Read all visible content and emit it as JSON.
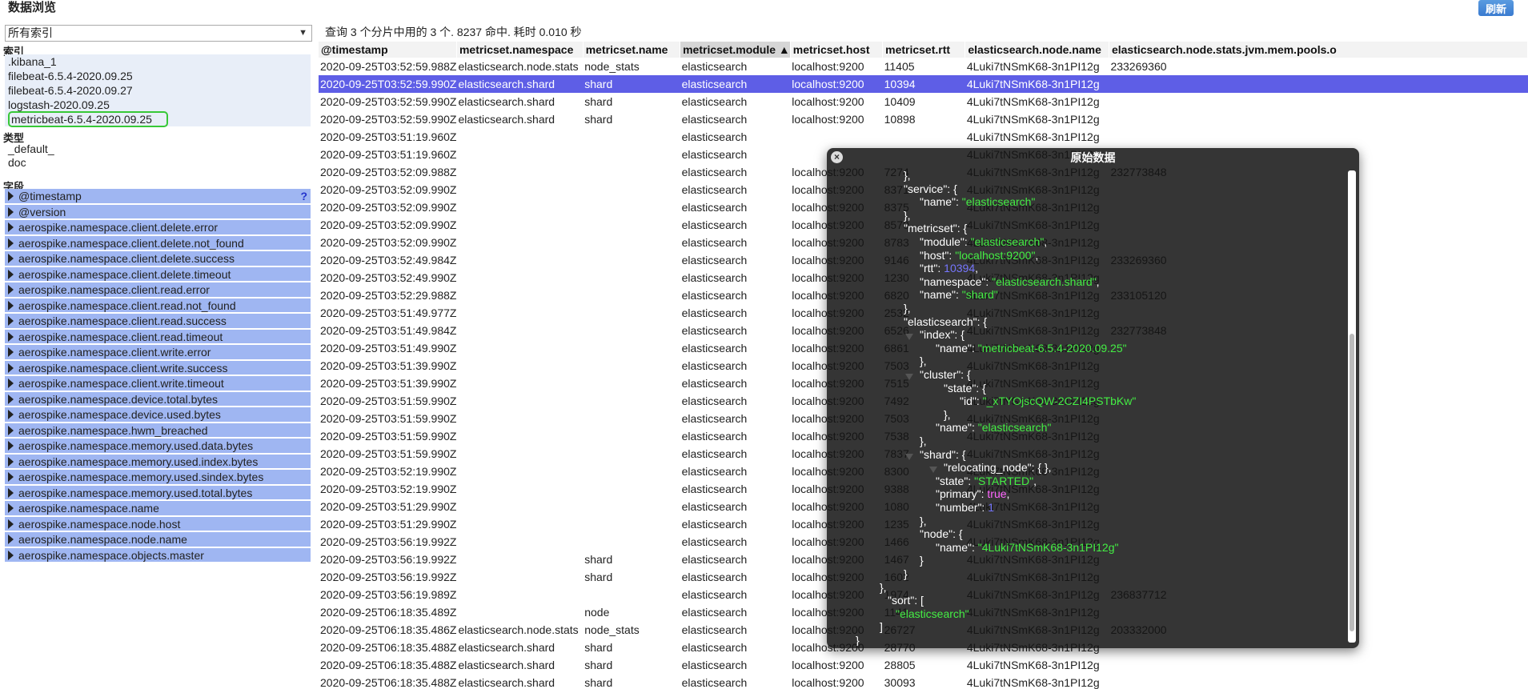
{
  "app": {
    "title": "数据浏览",
    "refresh_label": "刷新"
  },
  "sidebar": {
    "index_select": "所有索引",
    "index_heading": "索引",
    "indices": [
      ".kibana_1",
      "filebeat-6.5.4-2020.09.25",
      "filebeat-6.5.4-2020.09.27",
      "logstash-2020.09.25",
      "metricbeat-6.5.4-2020.09.25"
    ],
    "selected_index": 4,
    "type_heading": "类型",
    "types": [
      "_default_",
      "doc"
    ],
    "field_heading": "字段",
    "help_icon": "?",
    "fields": [
      "@timestamp",
      "@version",
      "aerospike.namespace.client.delete.error",
      "aerospike.namespace.client.delete.not_found",
      "aerospike.namespace.client.delete.success",
      "aerospike.namespace.client.delete.timeout",
      "aerospike.namespace.client.read.error",
      "aerospike.namespace.client.read.not_found",
      "aerospike.namespace.client.read.success",
      "aerospike.namespace.client.read.timeout",
      "aerospike.namespace.client.write.error",
      "aerospike.namespace.client.write.success",
      "aerospike.namespace.client.write.timeout",
      "aerospike.namespace.device.total.bytes",
      "aerospike.namespace.device.used.bytes",
      "aerospike.namespace.hwm_breached",
      "aerospike.namespace.memory.used.data.bytes",
      "aerospike.namespace.memory.used.index.bytes",
      "aerospike.namespace.memory.used.sindex.bytes",
      "aerospike.namespace.memory.used.total.bytes",
      "aerospike.namespace.name",
      "aerospike.namespace.node.host",
      "aerospike.namespace.node.name",
      "aerospike.namespace.objects.master"
    ]
  },
  "main": {
    "query_info": "查询 3 个分片中用的 3 个. 8237 命中. 耗时 0.010 秒",
    "columns": [
      "@timestamp",
      "metricset.namespace",
      "metricset.name",
      "metricset.module ▲",
      "metricset.host",
      "metricset.rtt",
      "elasticsearch.node.name",
      "elasticsearch.node.stats.jvm.mem.pools.o"
    ],
    "sorted_column": 3,
    "selected_row": 1,
    "rows": [
      [
        "2020-09-25T03:52:59.988Z",
        "elasticsearch.node.stats",
        "node_stats",
        "elasticsearch",
        "localhost:9200",
        "11405",
        "4Luki7tNSmK68-3n1PI12g",
        "233269360"
      ],
      [
        "2020-09-25T03:52:59.990Z",
        "elasticsearch.shard",
        "shard",
        "elasticsearch",
        "localhost:9200",
        "10394",
        "4Luki7tNSmK68-3n1PI12g",
        ""
      ],
      [
        "2020-09-25T03:52:59.990Z",
        "elasticsearch.shard",
        "shard",
        "elasticsearch",
        "localhost:9200",
        "10409",
        "4Luki7tNSmK68-3n1PI12g",
        ""
      ],
      [
        "2020-09-25T03:52:59.990Z",
        "elasticsearch.shard",
        "shard",
        "elasticsearch",
        "localhost:9200",
        "10898",
        "4Luki7tNSmK68-3n1PI12g",
        ""
      ],
      [
        "2020-09-25T03:51:19.960Z",
        "",
        "",
        "elasticsearch",
        "",
        "",
        "4Luki7tNSmK68-3n1PI12g",
        ""
      ],
      [
        "2020-09-25T03:51:19.960Z",
        "",
        "",
        "elasticsearch",
        "",
        "",
        "4Luki7tNSmK68-3n1PI12g",
        ""
      ],
      [
        "2020-09-25T03:52:09.988Z",
        "",
        "",
        "elasticsearch",
        "localhost:9200",
        "7274",
        "4Luki7tNSmK68-3n1PI12g",
        "232773848"
      ],
      [
        "2020-09-25T03:52:09.990Z",
        "",
        "",
        "elasticsearch",
        "localhost:9200",
        "8371",
        "4Luki7tNSmK68-3n1PI12g",
        ""
      ],
      [
        "2020-09-25T03:52:09.990Z",
        "",
        "",
        "elasticsearch",
        "localhost:9200",
        "8375",
        "4Luki7tNSmK68-3n1PI12g",
        ""
      ],
      [
        "2020-09-25T03:52:09.990Z",
        "",
        "",
        "elasticsearch",
        "localhost:9200",
        "8570",
        "4Luki7tNSmK68-3n1PI12g",
        ""
      ],
      [
        "2020-09-25T03:52:09.990Z",
        "",
        "",
        "elasticsearch",
        "localhost:9200",
        "8783",
        "4Luki7tNSmK68-3n1PI12g",
        ""
      ],
      [
        "2020-09-25T03:52:49.984Z",
        "",
        "",
        "elasticsearch",
        "localhost:9200",
        "9146",
        "4Luki7tNSmK68-3n1PI12g",
        "233269360"
      ],
      [
        "2020-09-25T03:52:49.990Z",
        "",
        "",
        "elasticsearch",
        "localhost:9200",
        "1230",
        "4Luki7tNSmK68-3n1PI12g",
        ""
      ],
      [
        "2020-09-25T03:52:29.988Z",
        "",
        "",
        "elasticsearch",
        "localhost:9200",
        "6820",
        "4Luki7tNSmK68-3n1PI12g",
        "233105120"
      ],
      [
        "2020-09-25T03:51:49.977Z",
        "",
        "",
        "elasticsearch",
        "localhost:9200",
        "2532",
        "4Luki7tNSmK68-3n1PI12g",
        ""
      ],
      [
        "2020-09-25T03:51:49.984Z",
        "",
        "",
        "elasticsearch",
        "localhost:9200",
        "6526",
        "4Luki7tNSmK68-3n1PI12g",
        "232773848"
      ],
      [
        "2020-09-25T03:51:49.990Z",
        "",
        "",
        "elasticsearch",
        "localhost:9200",
        "6861",
        "4Luki7tNSmK68-3n1PI12g",
        ""
      ],
      [
        "2020-09-25T03:51:39.990Z",
        "",
        "",
        "elasticsearch",
        "localhost:9200",
        "7503",
        "4Luki7tNSmK68-3n1PI12g",
        ""
      ],
      [
        "2020-09-25T03:51:39.990Z",
        "",
        "",
        "elasticsearch",
        "localhost:9200",
        "7515",
        "4Luki7tNSmK68-3n1PI12g",
        ""
      ],
      [
        "2020-09-25T03:51:59.990Z",
        "",
        "",
        "elasticsearch",
        "localhost:9200",
        "7492",
        "4Luki7tNSmK68-3n1PI12g",
        ""
      ],
      [
        "2020-09-25T03:51:59.990Z",
        "",
        "",
        "elasticsearch",
        "localhost:9200",
        "7503",
        "4Luki7tNSmK68-3n1PI12g",
        ""
      ],
      [
        "2020-09-25T03:51:59.990Z",
        "",
        "",
        "elasticsearch",
        "localhost:9200",
        "7538",
        "4Luki7tNSmK68-3n1PI12g",
        ""
      ],
      [
        "2020-09-25T03:51:59.990Z",
        "",
        "",
        "elasticsearch",
        "localhost:9200",
        "7837",
        "4Luki7tNSmK68-3n1PI12g",
        ""
      ],
      [
        "2020-09-25T03:52:19.990Z",
        "",
        "",
        "elasticsearch",
        "localhost:9200",
        "8300",
        "4Luki7tNSmK68-3n1PI12g",
        ""
      ],
      [
        "2020-09-25T03:52:19.990Z",
        "",
        "",
        "elasticsearch",
        "localhost:9200",
        "9388",
        "4Luki7tNSmK68-3n1PI12g",
        ""
      ],
      [
        "2020-09-25T03:51:29.990Z",
        "",
        "",
        "elasticsearch",
        "localhost:9200",
        "1080",
        "4Luki7tNSmK68-3n1PI12g",
        ""
      ],
      [
        "2020-09-25T03:51:29.990Z",
        "",
        "",
        "elasticsearch",
        "localhost:9200",
        "1235",
        "4Luki7tNSmK68-3n1PI12g",
        ""
      ],
      [
        "2020-09-25T03:56:19.992Z",
        "",
        "",
        "elasticsearch",
        "localhost:9200",
        "1466",
        "4Luki7tNSmK68-3n1PI12g",
        ""
      ],
      [
        "2020-09-25T03:56:19.992Z",
        "",
        "shard",
        "elasticsearch",
        "localhost:9200",
        "1467",
        "4Luki7tNSmK68-3n1PI12g",
        ""
      ],
      [
        "2020-09-25T03:56:19.992Z",
        "",
        "shard",
        "elasticsearch",
        "localhost:9200",
        "1602",
        "4Luki7tNSmK68-3n1PI12g",
        ""
      ],
      [
        "2020-09-25T03:56:19.989Z",
        "",
        "",
        "elasticsearch",
        "localhost:9200",
        "1974",
        "4Luki7tNSmK68-3n1PI12g",
        "236837712"
      ],
      [
        "2020-09-25T06:18:35.489Z",
        "",
        "node",
        "elasticsearch",
        "localhost:9200",
        "1141",
        "4Luki7tNSmK68-3n1PI12g",
        ""
      ],
      [
        "2020-09-25T06:18:35.486Z",
        "elasticsearch.node.stats",
        "node_stats",
        "elasticsearch",
        "localhost:9200",
        "26727",
        "4Luki7tNSmK68-3n1PI12g",
        "203332000"
      ],
      [
        "2020-09-25T06:18:35.488Z",
        "elasticsearch.shard",
        "shard",
        "elasticsearch",
        "localhost:9200",
        "28770",
        "4Luki7tNSmK68-3n1PI12g",
        ""
      ],
      [
        "2020-09-25T06:18:35.488Z",
        "elasticsearch.shard",
        "shard",
        "elasticsearch",
        "localhost:9200",
        "28805",
        "4Luki7tNSmK68-3n1PI12g",
        ""
      ],
      [
        "2020-09-25T06:18:35.488Z",
        "elasticsearch.shard",
        "shard",
        "elasticsearch",
        "localhost:9200",
        "30093",
        "4Luki7tNSmK68-3n1PI12g",
        ""
      ]
    ]
  },
  "modal": {
    "title": "原始数据",
    "close_icon": "×",
    "lines": [
      [
        [
          {
            "t": "},",
            "c": "k"
          }
        ]
      ],
      [
        [
          {
            "t": "\"service\": {",
            "c": "k"
          }
        ]
      ],
      [
        [
          {
            "t": "\"name\": ",
            "c": "k"
          },
          {
            "t": "\"elasticsearch\"",
            "c": "s"
          }
        ]
      ],
      [
        [
          {
            "t": "},",
            "c": "k"
          }
        ]
      ],
      [
        [
          {
            "t": "\"metricset\": {",
            "c": "k"
          }
        ]
      ],
      [
        [
          {
            "t": "\"module\": ",
            "c": "k"
          },
          {
            "t": "\"elasticsearch\"",
            "c": "s"
          },
          {
            "t": ",",
            "c": "k"
          }
        ]
      ],
      [
        [
          {
            "t": "\"host\": ",
            "c": "k"
          },
          {
            "t": "\"localhost:9200\"",
            "c": "s"
          },
          {
            "t": ",",
            "c": "k"
          }
        ]
      ],
      [
        [
          {
            "t": "\"rtt\": ",
            "c": "k"
          },
          {
            "t": "10394",
            "c": "n"
          },
          {
            "t": ",",
            "c": "k"
          }
        ]
      ],
      [
        [
          {
            "t": "\"namespace\": ",
            "c": "k"
          },
          {
            "t": "\"elasticsearch.shard\"",
            "c": "s"
          },
          {
            "t": ",",
            "c": "k"
          }
        ]
      ],
      [
        [
          {
            "t": "\"name\": ",
            "c": "k"
          },
          {
            "t": "\"shard\"",
            "c": "s"
          }
        ]
      ],
      [
        [
          {
            "t": "},",
            "c": "k"
          }
        ]
      ],
      [
        [
          {
            "t": "\"elasticsearch\": {",
            "c": "k"
          }
        ]
      ],
      [
        [
          {
            "t": "\"index\": {",
            "c": "k"
          }
        ]
      ],
      [
        [
          {
            "t": "\"name\": ",
            "c": "k"
          },
          {
            "t": "\"metricbeat-6.5.4-2020.09.25\"",
            "c": "s"
          }
        ]
      ],
      [
        [
          {
            "t": "},",
            "c": "k"
          }
        ]
      ],
      [
        [
          {
            "t": "\"cluster\": {",
            "c": "k"
          }
        ]
      ],
      [
        [
          {
            "t": "\"state\": {",
            "c": "k"
          }
        ]
      ],
      [
        [
          {
            "t": "\"id\": ",
            "c": "k"
          },
          {
            "t": "\"_xTYOjscQW-2CZI4PSTbKw\"",
            "c": "s"
          }
        ]
      ],
      [
        [
          {
            "t": "},",
            "c": "k"
          }
        ]
      ],
      [
        [
          {
            "t": "\"name\": ",
            "c": "k"
          },
          {
            "t": "\"elasticsearch\"",
            "c": "s"
          }
        ]
      ],
      [
        [
          {
            "t": "},",
            "c": "k"
          }
        ]
      ],
      [
        [
          {
            "t": "\"shard\": {",
            "c": "k"
          }
        ]
      ],
      [
        [
          {
            "t": "\"relocating_node\": { },",
            "c": "k"
          }
        ]
      ],
      [
        [
          {
            "t": "\"state\": ",
            "c": "k"
          },
          {
            "t": "\"STARTED\"",
            "c": "s"
          },
          {
            "t": ",",
            "c": "k"
          }
        ]
      ],
      [
        [
          {
            "t": "\"primary\": ",
            "c": "k"
          },
          {
            "t": "true",
            "c": "b"
          },
          {
            "t": ",",
            "c": "k"
          }
        ]
      ],
      [
        [
          {
            "t": "\"number\": ",
            "c": "k"
          },
          {
            "t": "1",
            "c": "n"
          }
        ]
      ],
      [
        [
          {
            "t": "},",
            "c": "k"
          }
        ]
      ],
      [
        [
          {
            "t": "\"node\": {",
            "c": "k"
          }
        ]
      ],
      [
        [
          {
            "t": "\"name\": ",
            "c": "k"
          },
          {
            "t": "\"4Luki7tNSmK68-3n1PI12g\"",
            "c": "s"
          }
        ]
      ],
      [
        [
          {
            "t": "}",
            "c": "k"
          }
        ]
      ],
      [
        [
          {
            "t": "}",
            "c": "k"
          }
        ]
      ],
      [
        [
          {
            "t": "},",
            "c": "k"
          }
        ]
      ],
      [
        [
          {
            "t": "\"sort\": [",
            "c": "k"
          }
        ]
      ],
      [
        [
          {
            "t": "\"elasticsearch\"",
            "c": "s"
          }
        ]
      ],
      [
        [
          {
            "t": "]",
            "c": "k"
          }
        ]
      ],
      [
        [
          {
            "t": "}",
            "c": "k"
          }
        ]
      ]
    ]
  },
  "colors": {
    "accent": "#3a7bd0",
    "field_bg": "#9fb6f2",
    "selected_row": "#5e5ee6",
    "json_string": "#44ee44",
    "json_number": "#7777ff",
    "json_bool": "#ff66ff"
  }
}
